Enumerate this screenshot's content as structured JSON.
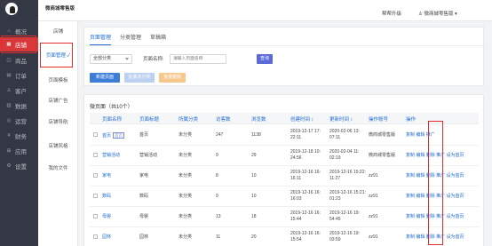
{
  "app": {
    "title": "微商城零售版"
  },
  "header": {
    "items": [
      "帮帮升级",
      "微商城零售版"
    ]
  },
  "sidebar": {
    "items": [
      {
        "icon": "home-icon",
        "label": "概况"
      },
      {
        "icon": "shop-icon",
        "label": "店铺"
      },
      {
        "icon": "goods-icon",
        "label": "商品"
      },
      {
        "icon": "order-icon",
        "label": "订单"
      },
      {
        "icon": "customer-icon",
        "label": "客户"
      },
      {
        "icon": "data-icon",
        "label": "数据"
      },
      {
        "icon": "marketing-icon",
        "label": "运营"
      },
      {
        "icon": "finance-icon",
        "label": "财务"
      },
      {
        "icon": "app-icon",
        "label": "应用"
      },
      {
        "icon": "settings-icon",
        "label": "设置"
      }
    ]
  },
  "subnav": {
    "items": [
      "店铺",
      "页面管理",
      "页面模板",
      "店铺广告",
      "店铺导航",
      "店铺风格",
      "我的文件"
    ]
  },
  "page": {
    "tabs": [
      "页面管理",
      "分类管理",
      "草稿箱"
    ],
    "filter": {
      "category": "全部分类",
      "name_label": "页面名称:",
      "name_placeholder": "请输入页面名称",
      "search": "查询"
    },
    "buttons": [
      "新建页面",
      "批量改分类",
      "批量删除"
    ]
  },
  "table": {
    "title": "微页面（共10个）",
    "columns": [
      "页面名称",
      "页面标题",
      "所属分类",
      "访客数",
      "浏览数",
      "创建时间 ↕",
      "更新时间 ↕",
      "操作账号",
      "操作"
    ],
    "rows": [
      {
        "name": "首页",
        "badge": "首页",
        "title": "首页",
        "cat": "未分类",
        "uv": "247",
        "pv": "1138",
        "created": "2019-12-17 17:\n22:11",
        "updated": "2020-02-06 13:\n07:11",
        "op": "微商城零售版",
        "actions": "复制 编辑 推广"
      },
      {
        "name": "营销活动",
        "badge": "",
        "title": "营销活动",
        "cat": "未分类",
        "uv": "9",
        "pv": "29",
        "created": "2019-12-18 10:\n24:56",
        "updated": "2020-02-04 11:\n02:19",
        "op": "微商城零售版",
        "actions": "复制 编辑 删除 推广 设为首页"
      },
      {
        "name": "家电",
        "badge": "",
        "title": "家电",
        "cat": "未分类",
        "uv": "8",
        "pv": "10",
        "created": "2019-12-16 16:\n16:11",
        "updated": "2019-12-16 15:22:\n11:27",
        "op": "zz91",
        "actions": "复制 编辑 删除 推广 设为首页"
      },
      {
        "name": "数码",
        "badge": "",
        "title": "数码",
        "cat": "未分类",
        "uv": "9",
        "pv": "10",
        "created": "2019-12-16 16:\n16:03",
        "updated": "2019-12-16 15:21:\n01:23",
        "op": "zz91",
        "actions": "复制 编辑 删除 推广 设为首页"
      },
      {
        "name": "母婴",
        "badge": "",
        "title": "母婴",
        "cat": "未分类",
        "uv": "13",
        "pv": "18",
        "created": "2019-12-16 16:\n15:44",
        "updated": "2019-12-16 19:\n54:45",
        "op": "zz91",
        "actions": "复制 编辑 删除 推广 设为首页"
      },
      {
        "name": "园林",
        "badge": "",
        "title": "园林",
        "cat": "未分类",
        "uv": "11",
        "pv": "20",
        "created": "2019-12-16 16:\n15:54",
        "updated": "2019-12-16 19:\n03:59",
        "op": "zz91",
        "actions": "复制 编辑 删除 推广 设为首页"
      }
    ]
  }
}
